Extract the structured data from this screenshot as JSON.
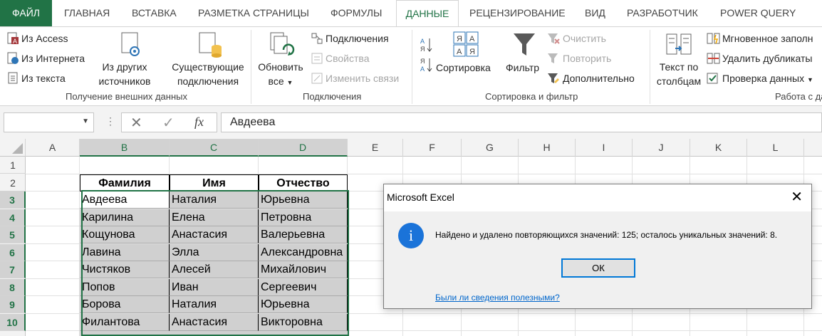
{
  "tabs": [
    "ФАЙЛ",
    "ГЛАВНАЯ",
    "ВСТАВКА",
    "РАЗМЕТКА СТРАНИЦЫ",
    "ФОРМУЛЫ",
    "ДАННЫЕ",
    "РЕЦЕНЗИРОВАНИЕ",
    "ВИД",
    "РАЗРАБОТЧИК",
    "POWER QUERY"
  ],
  "active_tab": "ДАННЫЕ",
  "ribbon": {
    "ext_data": {
      "from_access": "Из Access",
      "from_web": "Из Интернета",
      "from_text": "Из текста",
      "other_sources_1": "Из других",
      "other_sources_2": "источников",
      "existing_1": "Существующие",
      "existing_2": "подключения",
      "group": "Получение внешних данных"
    },
    "connections": {
      "refresh_1": "Обновить",
      "refresh_2": "все",
      "connections": "Подключения",
      "properties": "Свойства",
      "edit_links": "Изменить связи",
      "group": "Подключения"
    },
    "sort_filter": {
      "sort": "Сортировка",
      "filter": "Фильтр",
      "clear": "Очистить",
      "reapply": "Повторить",
      "advanced": "Дополнительно",
      "group": "Сортировка и фильтр"
    },
    "data_tools": {
      "text_to_cols_1": "Текст по",
      "text_to_cols_2": "столбцам",
      "flash_fill": "Мгновенное заполн",
      "remove_dup": "Удалить дубликаты",
      "validation": "Проверка данных",
      "group": "Работа с да"
    }
  },
  "formula_bar": {
    "name_box": "",
    "content": "Авдеева",
    "fx": "fx"
  },
  "columns": [
    "A",
    "B",
    "C",
    "D",
    "E",
    "F",
    "G",
    "H",
    "I",
    "J",
    "K",
    "L"
  ],
  "rows": [
    "1",
    "2",
    "3",
    "4",
    "5",
    "6",
    "7",
    "8",
    "9",
    "10"
  ],
  "table": {
    "headers": [
      "Фамилия",
      "Имя",
      "Отчество"
    ],
    "rows": [
      [
        "Авдеева",
        "Наталия",
        "Юрьевна"
      ],
      [
        "Карилина",
        "Елена",
        "Петровна"
      ],
      [
        "Кощунова",
        "Анастасия",
        "Валерьевна"
      ],
      [
        "Лавина",
        "Элла",
        "Александровна"
      ],
      [
        "Чистяков",
        "Алесей",
        "Михайлович"
      ],
      [
        "Попов",
        "Иван",
        "Сергеевич"
      ],
      [
        "Борова",
        "Наталия",
        "Юрьевна"
      ],
      [
        "Филантова",
        "Анастасия",
        "Викторовна"
      ]
    ]
  },
  "dialog": {
    "title": "Microsoft Excel",
    "message": "Найдено и удалено повторяющихся значений: 125; осталось уникальных значений: 8.",
    "ok": "ОК",
    "link": "Были ли сведения полезными?",
    "icon": "info-icon",
    "icon_glyph": "i"
  },
  "colors": {
    "accent": "#217346",
    "dialog_icon": "#1a73d9",
    "link": "#0066cc"
  }
}
